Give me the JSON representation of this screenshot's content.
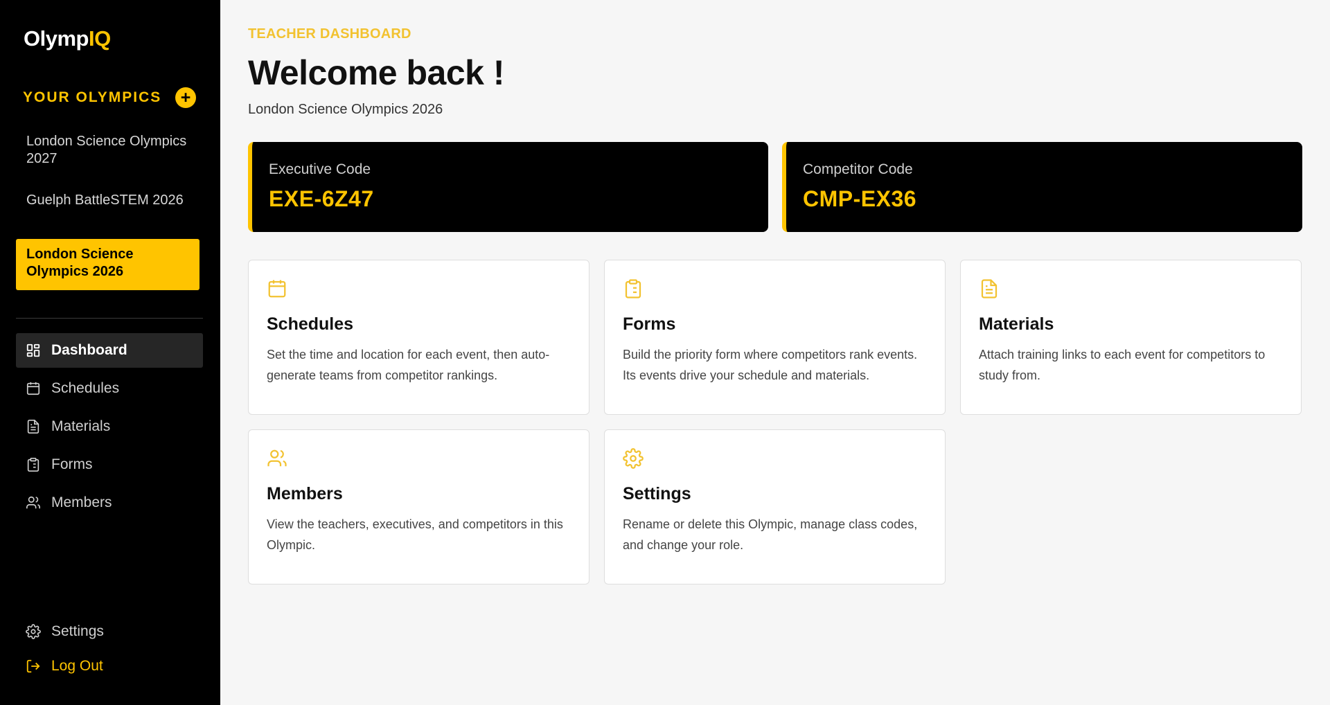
{
  "brand": {
    "name_a": "Olymp",
    "name_b": "IQ",
    "accent": "#FFC400"
  },
  "sidebar": {
    "section_title": "YOUR OLYMPICS",
    "add_icon": "plus-icon",
    "olympics": [
      {
        "label": "London Science Olympics 2027",
        "active": false
      },
      {
        "label": "Guelph BattleSTEM 2026",
        "active": false
      },
      {
        "label": "London Science Olympics 2026",
        "active": true
      }
    ],
    "nav": [
      {
        "label": "Dashboard",
        "icon": "dashboard-icon",
        "active": true
      },
      {
        "label": "Schedules",
        "icon": "calendar-icon"
      },
      {
        "label": "Materials",
        "icon": "document-icon"
      },
      {
        "label": "Forms",
        "icon": "clipboard-icon"
      },
      {
        "label": "Members",
        "icon": "users-icon"
      }
    ],
    "footer": [
      {
        "label": "Settings",
        "icon": "gear-icon"
      },
      {
        "label": "Log Out",
        "icon": "logout-icon"
      }
    ]
  },
  "header": {
    "eyebrow": "TEACHER DASHBOARD",
    "title": "Welcome back !",
    "subtitle": "London Science Olympics 2026"
  },
  "codes": [
    {
      "label": "Executive Code",
      "value": "EXE-6Z47"
    },
    {
      "label": "Competitor Code",
      "value": "CMP-EX36"
    }
  ],
  "tiles": [
    {
      "title": "Schedules",
      "icon": "calendar-icon",
      "desc": "Set the time and location for each event, then auto-generate teams from competitor rankings."
    },
    {
      "title": "Forms",
      "icon": "clipboard-icon",
      "desc": "Build the priority form where competitors rank events. Its events drive your schedule and materials."
    },
    {
      "title": "Materials",
      "icon": "document-icon",
      "desc": "Attach training links to each event for competitors to study from."
    },
    {
      "title": "Members",
      "icon": "users-icon",
      "desc": "View the teachers, executives, and competitors in this Olympic."
    },
    {
      "title": "Settings",
      "icon": "gear-icon",
      "desc": "Rename or delete this Olympic, manage class codes, and change your role."
    }
  ]
}
